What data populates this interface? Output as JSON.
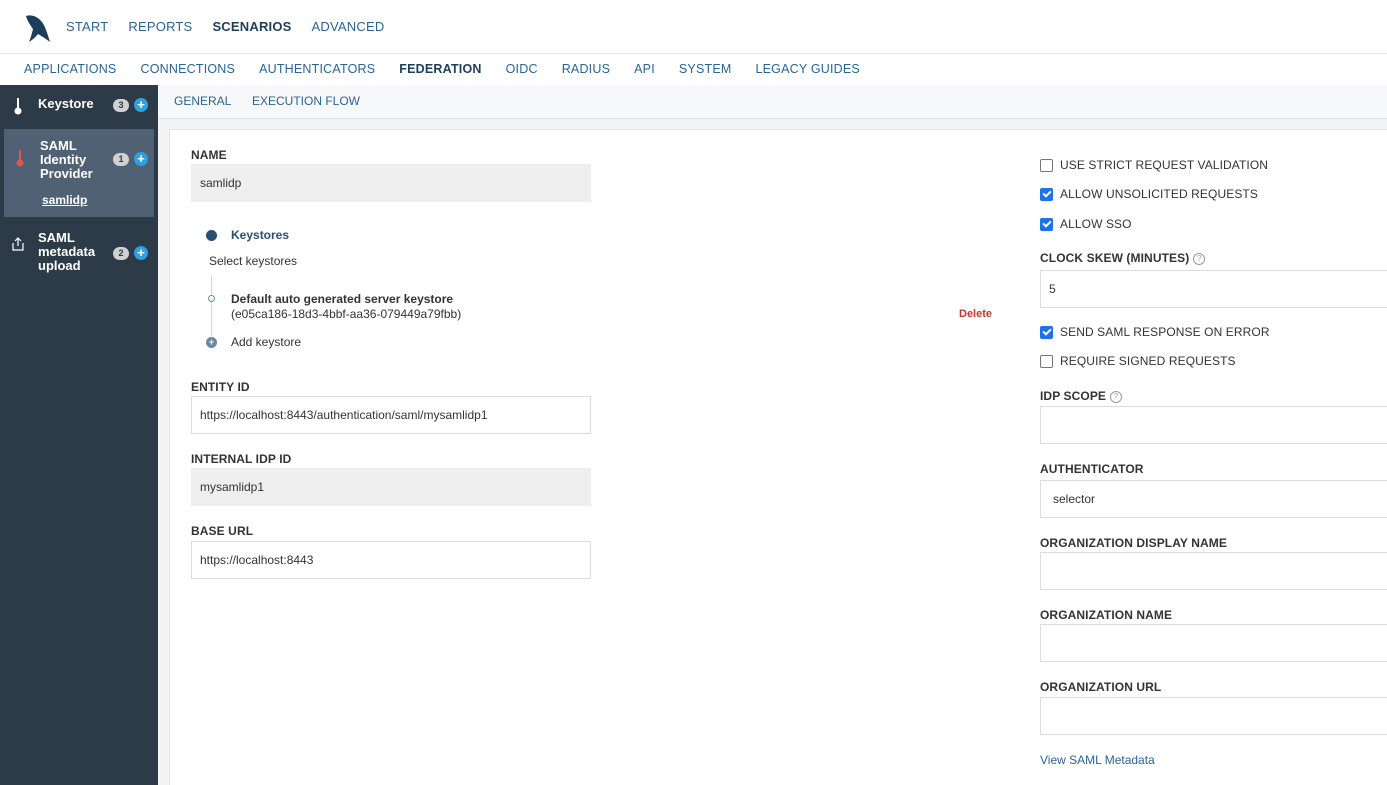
{
  "topnav": {
    "items": [
      "START",
      "REPORTS",
      "SCENARIOS",
      "ADVANCED"
    ],
    "active": "SCENARIOS"
  },
  "subnav": {
    "items": [
      "APPLICATIONS",
      "CONNECTIONS",
      "AUTHENTICATORS",
      "FEDERATION",
      "OIDC",
      "RADIUS",
      "API",
      "SYSTEM",
      "LEGACY GUIDES"
    ],
    "active": "FEDERATION"
  },
  "sidebar": {
    "items": [
      {
        "label": "Keystore",
        "count": "3",
        "icon": "key-icon"
      },
      {
        "label": "SAML Identity Provider",
        "count": "1",
        "icon": "thermometer-icon",
        "selected": true,
        "sub": "samlidp"
      },
      {
        "label": "SAML metadata upload",
        "count": "2",
        "icon": "upload-icon"
      }
    ]
  },
  "tabs": {
    "general": "GENERAL",
    "execution_flow": "EXECUTION FLOW"
  },
  "form": {
    "name_label": "NAME",
    "name_value": "samlidp",
    "keystores_title": "Keystores",
    "keystores_hint": "Select keystores",
    "keystore_name": "Default auto generated server keystore",
    "keystore_id": "(e05ca186-18d3-4bbf-aa36-079449a79fbb)",
    "delete_label": "Delete",
    "add_keystore": "Add keystore",
    "entity_id_label": "ENTITY ID",
    "entity_id_value": "https://localhost:8443/authentication/saml/mysamlidp1",
    "internal_idp_label": "INTERNAL IDP ID",
    "internal_idp_value": "mysamlidp1",
    "base_url_label": "BASE URL",
    "base_url_value": "https://localhost:8443"
  },
  "options": {
    "strict_validation": {
      "label": "USE STRICT REQUEST VALIDATION",
      "checked": false
    },
    "unsolicited": {
      "label": "ALLOW UNSOLICITED REQUESTS",
      "checked": true
    },
    "sso": {
      "label": "ALLOW SSO",
      "checked": true
    },
    "clock_skew_label": "CLOCK SKEW (MINUTES)",
    "clock_skew_value": "5",
    "send_on_error": {
      "label": "SEND SAML RESPONSE ON ERROR",
      "checked": true
    },
    "require_signed": {
      "label": "REQUIRE SIGNED REQUESTS",
      "checked": false
    },
    "idp_scope_label": "IDP SCOPE",
    "idp_scope_value": "",
    "authenticator_label": "AUTHENTICATOR",
    "authenticator_value": "selector",
    "org_display_label": "ORGANIZATION DISPLAY NAME",
    "org_display_value": "",
    "org_name_label": "ORGANIZATION NAME",
    "org_name_value": "",
    "org_url_label": "ORGANIZATION URL",
    "org_url_value": "",
    "view_metadata": "View SAML Metadata"
  },
  "colors": {
    "link": "#2a6496",
    "sidebar": "#2d3a47",
    "delete": "#c0392b",
    "checkbox": "#1a73e8"
  }
}
